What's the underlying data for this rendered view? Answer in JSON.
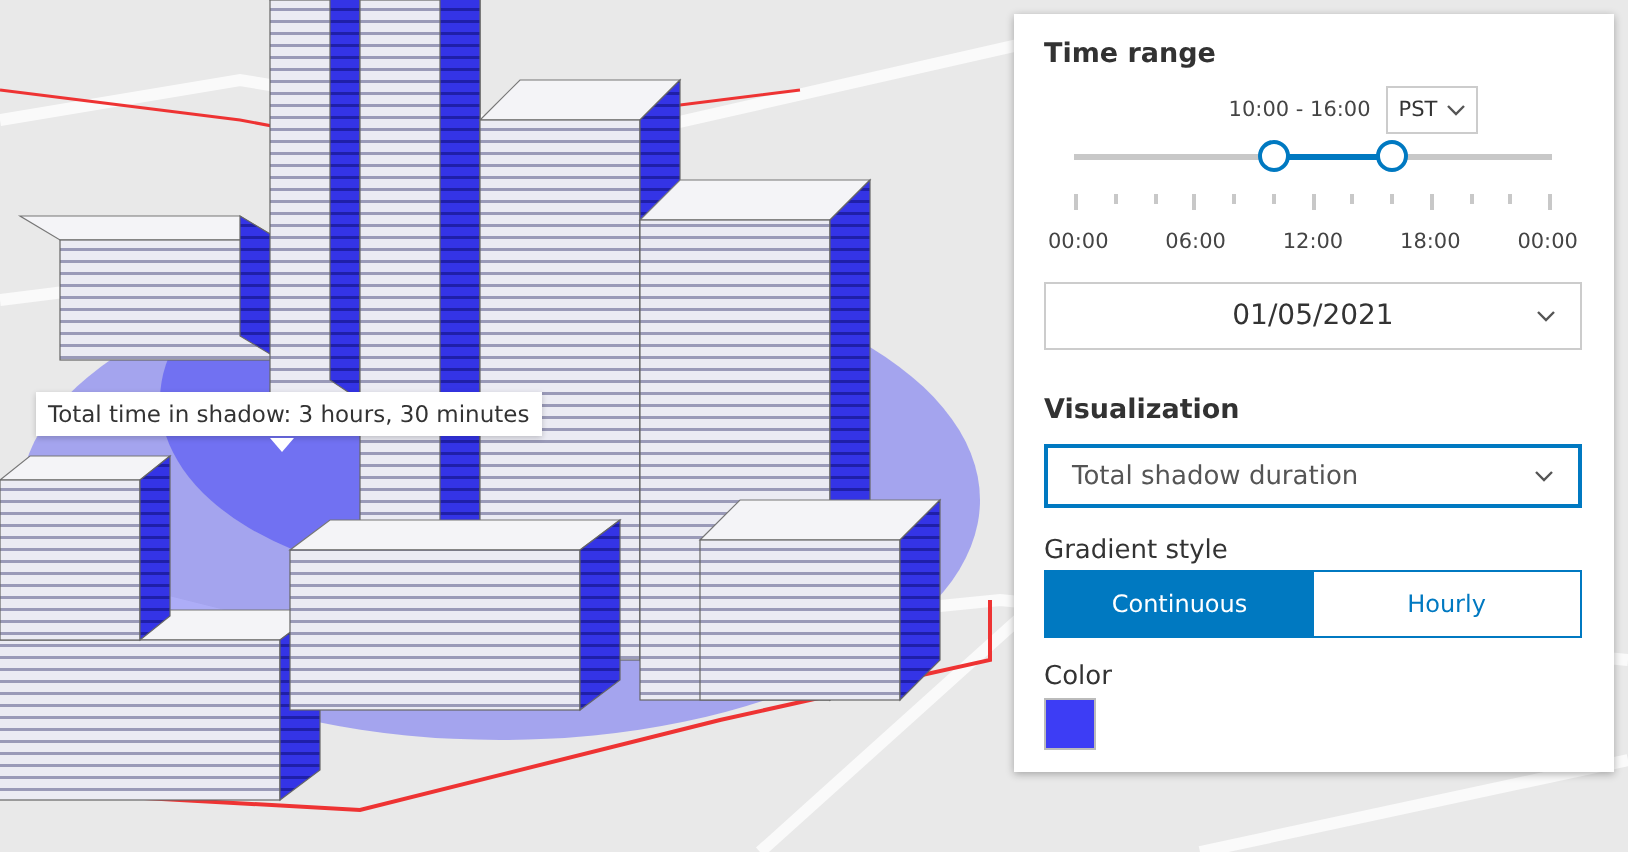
{
  "tooltip": {
    "text": "Total time in shadow: 3 hours, 30 minutes"
  },
  "panel": {
    "time_range": {
      "title": "Time range",
      "range_text": "10:00 - 16:00",
      "timezone": "PST",
      "thumbs": [
        {
          "level": 0.4167
        },
        {
          "level": 0.6667
        }
      ],
      "tick_labels": [
        "00:00",
        "06:00",
        "12:00",
        "18:00",
        "00:00"
      ],
      "date": "01/05/2021"
    },
    "visualization": {
      "title": "Visualization",
      "value": "Total shadow duration"
    },
    "gradient_style": {
      "label": "Gradient style",
      "options": [
        {
          "label": "Continuous",
          "selected": true
        },
        {
          "label": "Hourly",
          "selected": false
        }
      ]
    },
    "color": {
      "label": "Color",
      "color": "#3d3df5"
    }
  }
}
